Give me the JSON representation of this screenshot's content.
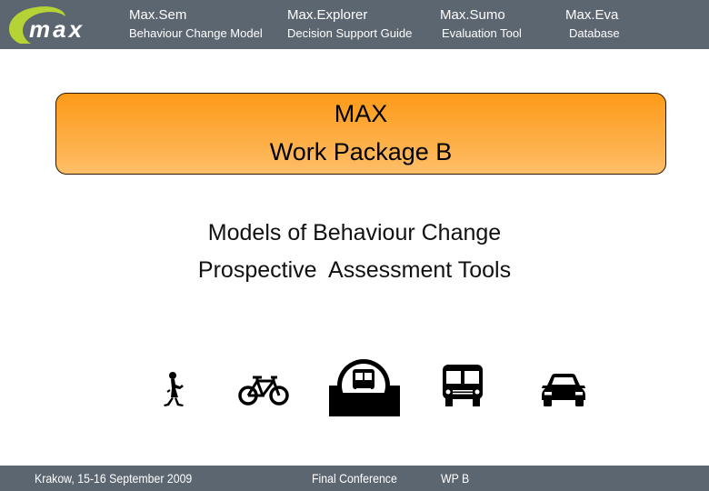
{
  "header": {
    "logo": {
      "text": "max",
      "icon": "max-swoosh-logo"
    },
    "nav": [
      {
        "title": "Max.Sem",
        "subtitle": "Behaviour Change Model"
      },
      {
        "title": "Max.Explorer",
        "subtitle": "Decision Support Guide"
      },
      {
        "title": "Max.Sumo",
        "subtitle": "Evaluation Tool"
      },
      {
        "title": "Max.Eva",
        "subtitle": "Database"
      }
    ]
  },
  "title_box": {
    "line1": "MAX",
    "line2": "Work Package B"
  },
  "subtitle": {
    "line1": "Models of Behaviour Change",
    "line2": "Prospective  Assessment Tools"
  },
  "transport_icons": [
    "pedestrian-icon",
    "bicycle-icon",
    "metro-icon",
    "bus-icon",
    "car-icon"
  ],
  "footer": {
    "location_date": "Krakow, 15-16 September 2009",
    "event": "Final Conference",
    "package": "WP B"
  },
  "colors": {
    "bar": "#5c6670",
    "accent_green": "#b5d334",
    "orange_top": "#fd9a18",
    "orange_bottom": "#febf6a"
  }
}
